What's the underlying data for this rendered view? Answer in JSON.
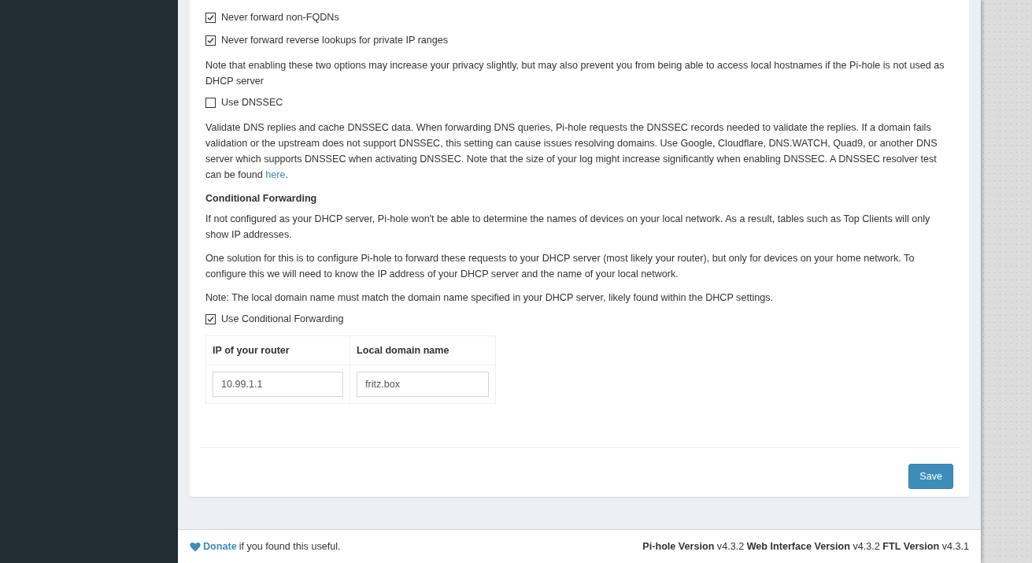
{
  "settings": [
    {
      "kind": "checkbox",
      "label": "Never forward non-FQDNs",
      "checked": true
    },
    {
      "kind": "checkbox",
      "label": "Never forward reverse lookups for private IP ranges",
      "checked": true
    },
    {
      "kind": "paragraph",
      "text": "Note that enabling these two options may increase your privacy slightly, but may also prevent you from being able to access local hostnames if the Pi-hole is not used as DHCP server"
    },
    {
      "kind": "checkbox",
      "label": "Use DNSSEC",
      "checked": false
    },
    {
      "kind": "paragraph",
      "text": "Validate DNS replies and cache DNSSEC data. When forwarding DNS queries, Pi-hole requests the DNSSEC records needed to validate the replies. If a domain fails validation or the upstream does not support DNSSEC, this setting can cause issues resolving domains. Use Google, Cloudflare, DNS.WATCH, Quad9, or another DNS server which supports DNSSEC when activating DNSSEC. Note that the size of your log might increase significantly when enabling DNSSEC. A DNSSEC resolver test can be found ",
      "link": "here",
      "after": "."
    },
    {
      "kind": "heading",
      "text": "Conditional Forwarding"
    },
    {
      "kind": "paragraph",
      "text": "If not configured as your DHCP server, Pi-hole won't be able to determine the names of devices on your local network. As a result, tables such as Top Clients will only show IP addresses."
    },
    {
      "kind": "paragraph",
      "text": "One solution for this is to configure Pi-hole to forward these requests to your DHCP server (most likely your router), but only for devices on your home network. To configure this we will need to know the IP address of your DHCP server and the name of your local network."
    },
    {
      "kind": "paragraph",
      "text": "Note: The local domain name must match the domain name specified in your DHCP server, likely found within the DHCP settings."
    },
    {
      "kind": "checkbox",
      "label": "Use Conditional Forwarding",
      "checked": true
    }
  ],
  "forwarding_table": {
    "columns": [
      "IP of your router",
      "Local domain name"
    ],
    "values": [
      "10.99.1.1",
      "fritz.box"
    ]
  },
  "save_button": "Save",
  "footer": {
    "donate_link": "Donate",
    "donate_text": "if you found this useful.",
    "versions": [
      {
        "label": "Pi-hole Version",
        "value": "v4.3.2"
      },
      {
        "label": "Web Interface Version",
        "value": "v4.3.2"
      },
      {
        "label": "FTL Version",
        "value": "v4.3.1"
      }
    ]
  }
}
